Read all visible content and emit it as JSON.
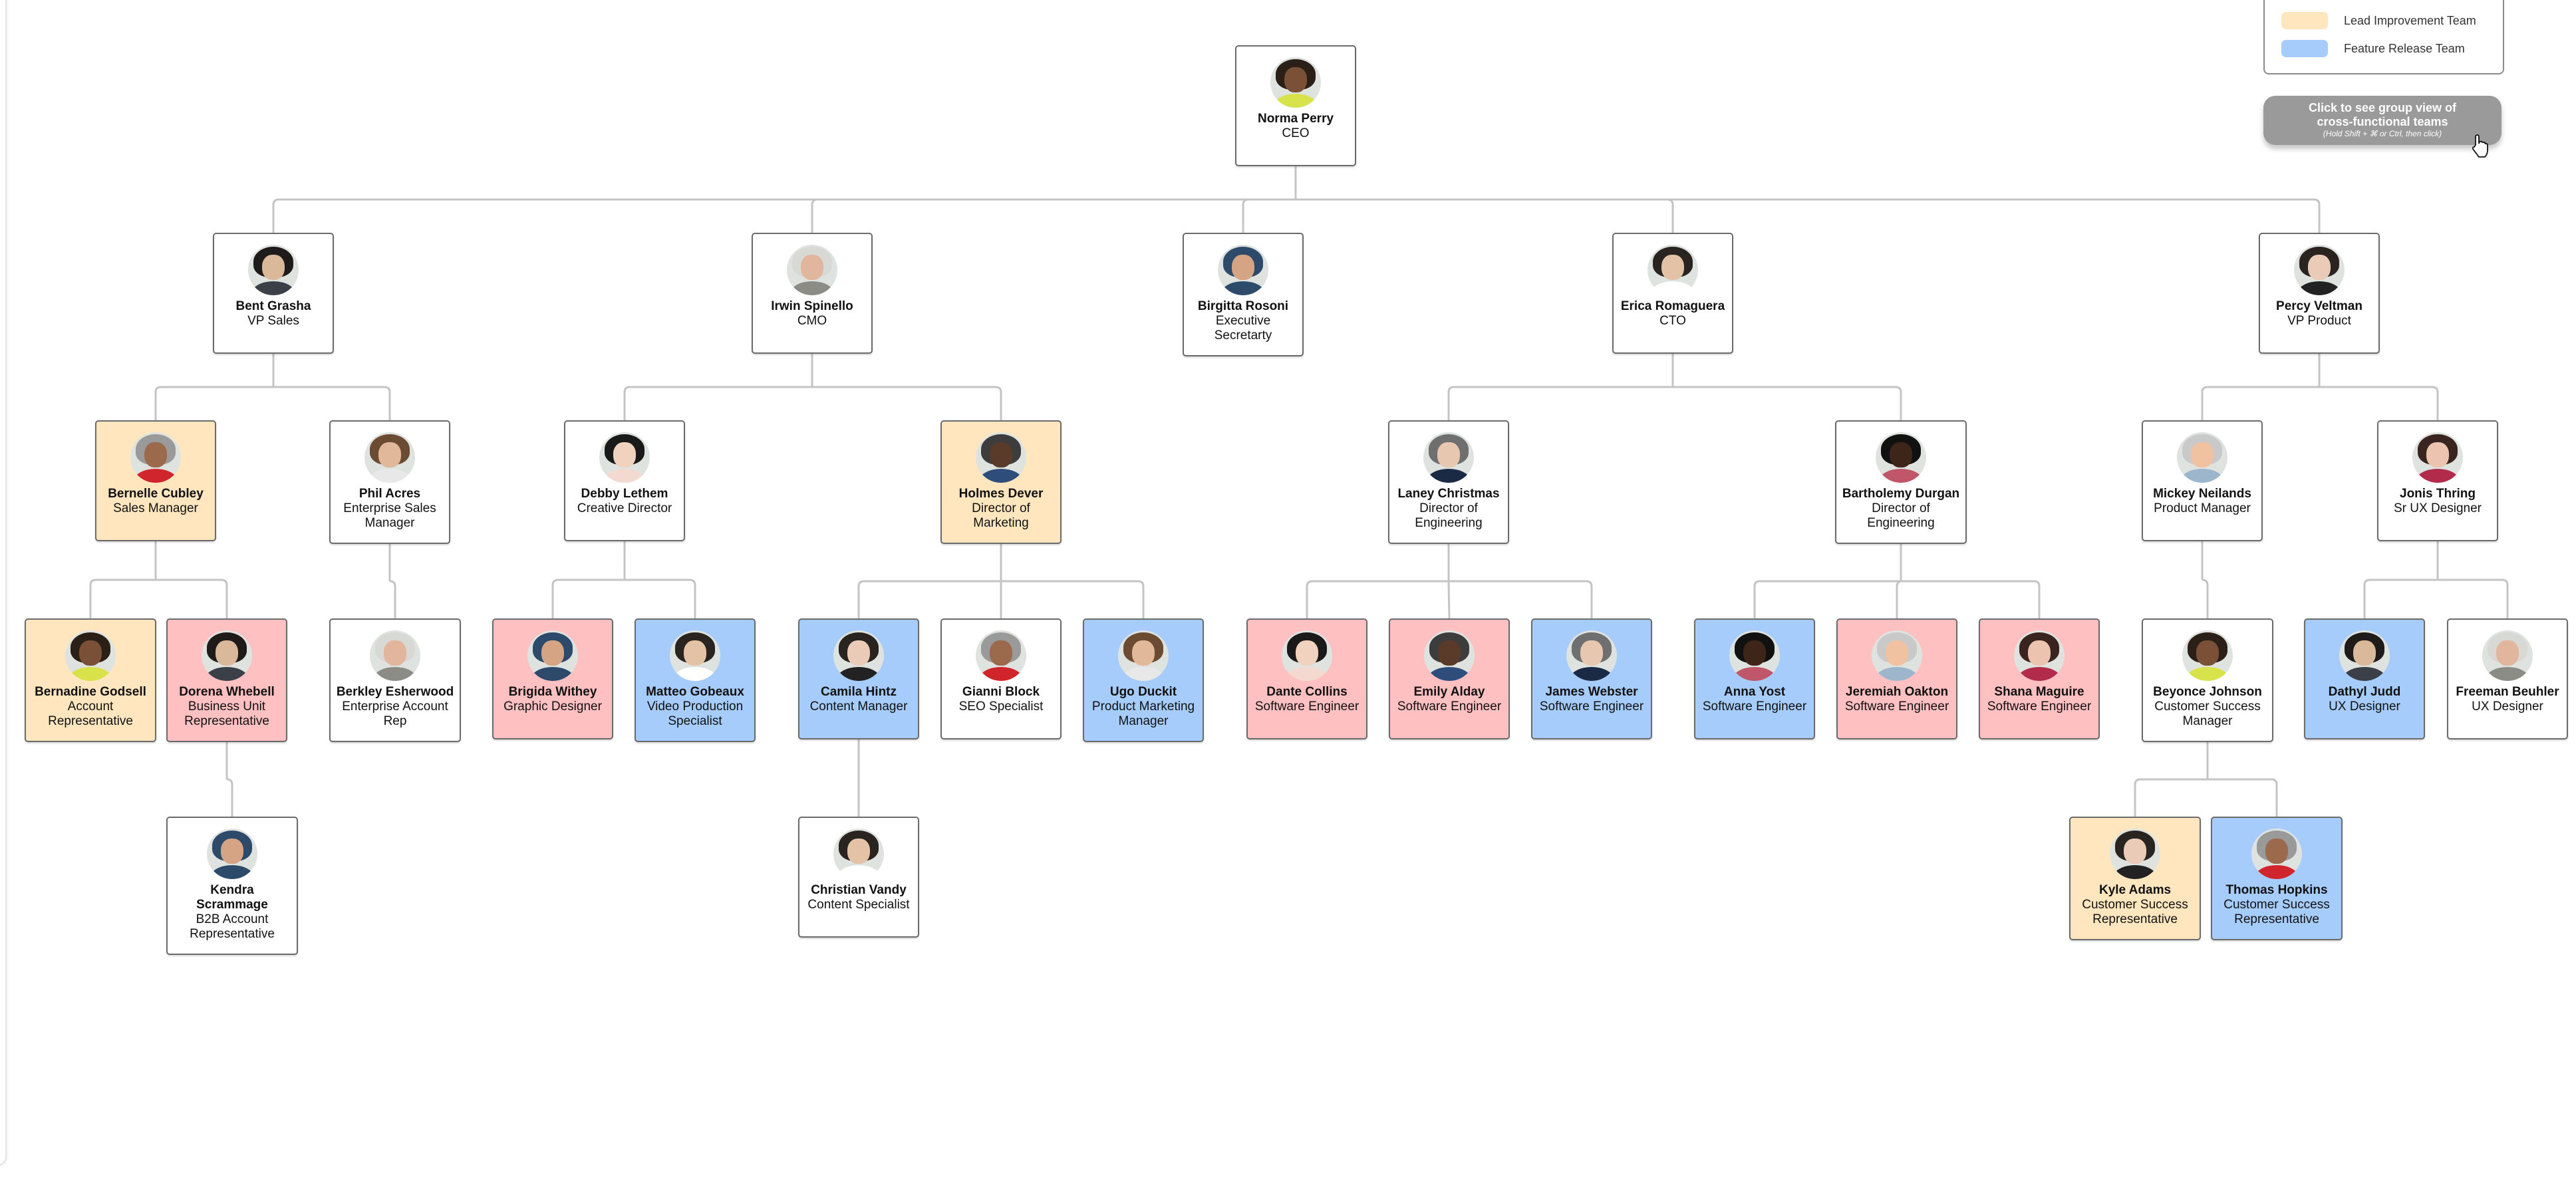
{
  "legend": {
    "items": [
      {
        "label": "Lead Improvement Team",
        "color": "#ffe6bf"
      },
      {
        "label": "Feature Release Team",
        "color": "#a6ccfc"
      }
    ],
    "partially_hidden_item_color": "#ffc0c2"
  },
  "group_view_button": {
    "label": "Click to see group view of cross-functional teams",
    "hint": "(Hold Shift + ⌘ or Ctrl, then click)"
  },
  "team_colors": {
    "lead_improvement": "#ffe6bf",
    "feature_release": "#a6ccfc",
    "pink_team": "#ffc0c2",
    "none": "#ffffff"
  },
  "people": [
    {
      "id": "norma",
      "name": "Norma Perry",
      "title": "CEO",
      "team": "none",
      "parent": null
    },
    {
      "id": "bent",
      "name": "Bent Grasha",
      "title": "VP Sales",
      "team": "none",
      "parent": "norma"
    },
    {
      "id": "irwin",
      "name": "Irwin Spinello",
      "title": "CMO",
      "team": "none",
      "parent": "norma"
    },
    {
      "id": "birgitta",
      "name": "Birgitta Rosoni",
      "title": "Executive Secretarty",
      "team": "none",
      "parent": "norma"
    },
    {
      "id": "erica",
      "name": "Erica Romaguera",
      "title": "CTO",
      "team": "none",
      "parent": "norma"
    },
    {
      "id": "percy",
      "name": "Percy Veltman",
      "title": "VP Product",
      "team": "none",
      "parent": "norma"
    },
    {
      "id": "bernelle",
      "name": "Bernelle Cubley",
      "title": "Sales Manager",
      "team": "lead_improvement",
      "parent": "bent"
    },
    {
      "id": "phil",
      "name": "Phil Acres",
      "title": "Enterprise Sales Manager",
      "team": "none",
      "parent": "bent"
    },
    {
      "id": "debby",
      "name": "Debby Lethem",
      "title": "Creative Director",
      "team": "none",
      "parent": "irwin"
    },
    {
      "id": "holmes",
      "name": "Holmes Dever",
      "title": "Director of Marketing",
      "team": "lead_improvement",
      "parent": "irwin"
    },
    {
      "id": "laney",
      "name": "Laney Christmas",
      "title": "Director of Engineering",
      "team": "none",
      "parent": "erica"
    },
    {
      "id": "bartholemy",
      "name": "Bartholemy Durgan",
      "title": "Director of Engineering",
      "team": "none",
      "parent": "erica"
    },
    {
      "id": "mickey",
      "name": "Mickey Neilands",
      "title": "Product Manager",
      "team": "none",
      "parent": "percy"
    },
    {
      "id": "jonis",
      "name": "Jonis Thring",
      "title": "Sr UX Designer",
      "team": "none",
      "parent": "percy"
    },
    {
      "id": "bernadine",
      "name": "Bernadine Godsell",
      "title": "Account Representative",
      "team": "lead_improvement",
      "parent": "bernelle"
    },
    {
      "id": "dorena",
      "name": "Dorena Whebell",
      "title": "Business Unit Representative",
      "team": "pink_team",
      "parent": "bernelle"
    },
    {
      "id": "berkley",
      "name": "Berkley Esherwood",
      "title": "Enterprise Account Rep",
      "team": "none",
      "parent": "phil"
    },
    {
      "id": "brigida",
      "name": "Brigida Withey",
      "title": "Graphic Designer",
      "team": "pink_team",
      "parent": "debby"
    },
    {
      "id": "matteo",
      "name": "Matteo Gobeaux",
      "title": "Video Production Specialist",
      "team": "feature_release",
      "parent": "debby"
    },
    {
      "id": "camila",
      "name": "Camila Hintz",
      "title": "Content Manager",
      "team": "feature_release",
      "parent": "holmes"
    },
    {
      "id": "gianni",
      "name": "Gianni Block",
      "title": "SEO Specialist",
      "team": "none",
      "parent": "holmes"
    },
    {
      "id": "ugo",
      "name": "Ugo Duckit",
      "title": "Product Marketing Manager",
      "team": "feature_release",
      "parent": "holmes"
    },
    {
      "id": "dante",
      "name": "Dante Collins",
      "title": "Software Engineer",
      "team": "pink_team",
      "parent": "laney"
    },
    {
      "id": "emily",
      "name": "Emily Alday",
      "title": "Software Engineer",
      "team": "pink_team",
      "parent": "laney"
    },
    {
      "id": "james",
      "name": "James Webster",
      "title": "Software Engineer",
      "team": "feature_release",
      "parent": "laney"
    },
    {
      "id": "anna",
      "name": "Anna Yost",
      "title": "Software Engineer",
      "team": "feature_release",
      "parent": "bartholemy"
    },
    {
      "id": "jeremiah",
      "name": "Jeremiah Oakton",
      "title": "Software Engineer",
      "team": "pink_team",
      "parent": "bartholemy"
    },
    {
      "id": "shana",
      "name": "Shana Maguire",
      "title": "Software Engineer",
      "team": "pink_team",
      "parent": "bartholemy"
    },
    {
      "id": "beyonce",
      "name": "Beyonce Johnson",
      "title": "Customer Success Manager",
      "team": "none",
      "parent": "mickey"
    },
    {
      "id": "dathyl",
      "name": "Dathyl Judd",
      "title": "UX Designer",
      "team": "feature_release",
      "parent": "jonis"
    },
    {
      "id": "freeman",
      "name": "Freeman Beuhler",
      "title": "UX Designer",
      "team": "none",
      "parent": "jonis"
    },
    {
      "id": "kendra",
      "name": "Kendra Scrammage",
      "title": "B2B Account Representative",
      "team": "none",
      "parent": "dorena"
    },
    {
      "id": "christian",
      "name": "Christian Vandy",
      "title": "Content Specialist",
      "team": "none",
      "parent": "camila"
    },
    {
      "id": "kyle",
      "name": "Kyle Adams",
      "title": "Customer Success Representative",
      "team": "lead_improvement",
      "parent": "beyonce"
    },
    {
      "id": "thomas",
      "name": "Thomas Hopkins",
      "title": "Customer Success Representative",
      "team": "feature_release",
      "parent": "beyonce"
    }
  ]
}
